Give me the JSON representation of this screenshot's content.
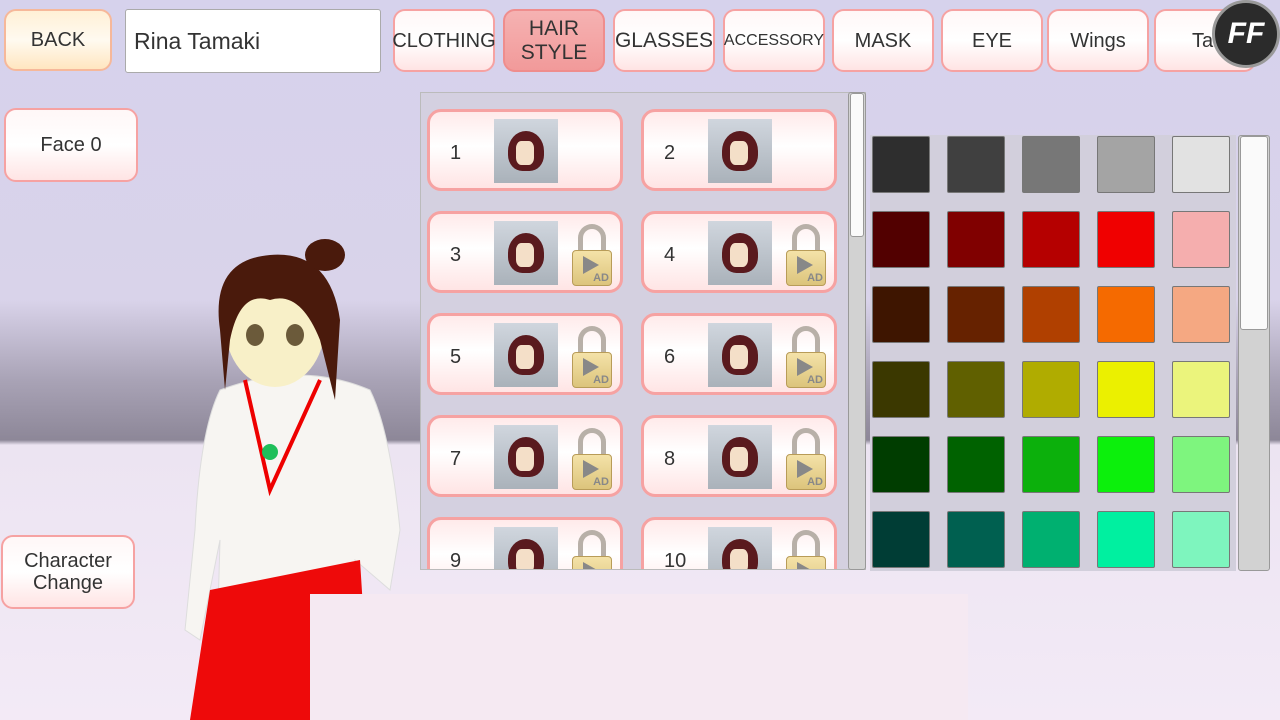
{
  "header": {
    "back_label": "BACK",
    "character_name": "Rina Tamaki",
    "tabs": [
      {
        "label": "CLOTHING"
      },
      {
        "label": "HAIR STYLE"
      },
      {
        "label": "GLASSES"
      },
      {
        "label": "ACCESSORY"
      },
      {
        "label": "MASK"
      },
      {
        "label": "EYE"
      },
      {
        "label": "Wings"
      },
      {
        "label": "Tail"
      }
    ],
    "active_tab": "HAIR STYLE",
    "logo_text": "FF"
  },
  "left": {
    "face_label": "Face 0",
    "character_change_label": "Character Change"
  },
  "hairstyles": [
    {
      "num": "1",
      "locked": false
    },
    {
      "num": "2",
      "locked": false
    },
    {
      "num": "3",
      "locked": true
    },
    {
      "num": "4",
      "locked": true
    },
    {
      "num": "5",
      "locked": true
    },
    {
      "num": "6",
      "locked": true
    },
    {
      "num": "7",
      "locked": true
    },
    {
      "num": "8",
      "locked": true
    },
    {
      "num": "9",
      "locked": true
    },
    {
      "num": "10",
      "locked": true
    }
  ],
  "lock_badge": "AD",
  "palette": [
    [
      "#2e2e2e",
      "#404040",
      "#777777",
      "#a4a4a4",
      "#e2e2e2"
    ],
    [
      "#520000",
      "#800000",
      "#b50000",
      "#f00000",
      "#f5aeae"
    ],
    [
      "#3e1500",
      "#662200",
      "#b04000",
      "#f56a00",
      "#f5a882"
    ],
    [
      "#3b3800",
      "#606000",
      "#b0ac00",
      "#ebf000",
      "#ebf47c"
    ],
    [
      "#003d00",
      "#006200",
      "#0cb00c",
      "#0cf00c",
      "#7ef57e"
    ],
    [
      "#003d35",
      "#006050",
      "#00b070",
      "#00f0a0",
      "#7ef5be"
    ]
  ]
}
